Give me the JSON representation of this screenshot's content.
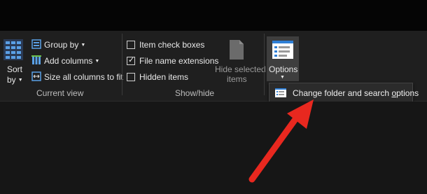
{
  "ribbon": {
    "sort": {
      "line1": "Sort",
      "line2": "by"
    },
    "current_view": {
      "group_by": "Group by",
      "add_columns": "Add columns",
      "size_columns": "Size all columns to fit",
      "group_label": "Current view"
    },
    "show_hide": {
      "item_check_boxes": {
        "label": "Item check boxes",
        "checked": false
      },
      "file_name_extensions": {
        "label": "File name extensions",
        "checked": true
      },
      "hidden_items": {
        "label": "Hidden items",
        "checked": false
      },
      "hide_selected": {
        "line1": "Hide selected",
        "line2": "items"
      },
      "group_label": "Show/hide"
    },
    "options": {
      "label": "Options"
    }
  },
  "dropdown": {
    "item_label_prefix": "Change folder and search ",
    "item_label_accel": "o",
    "item_label_suffix": "ptions"
  },
  "colors": {
    "arrow": "#e8281f",
    "ribbon_bg": "#1f1f1f",
    "highlight": "#3e3e3e"
  }
}
